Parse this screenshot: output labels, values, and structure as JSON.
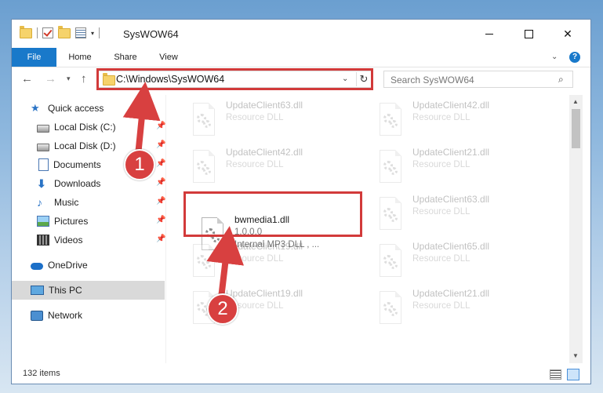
{
  "window": {
    "title": "SysWOW64"
  },
  "ribbon": {
    "tabs": [
      "File",
      "Home",
      "Share",
      "View"
    ]
  },
  "nav": {
    "address": "C:\\Windows\\SysWOW64",
    "search_placeholder": "Search SysWOW64"
  },
  "sidebar": {
    "items": [
      {
        "label": "Quick access",
        "icon": "star-icon"
      },
      {
        "label": "Local Disk (C:)",
        "icon": "disk-icon",
        "pinned": true
      },
      {
        "label": "Local Disk (D:)",
        "icon": "disk-icon",
        "pinned": true
      },
      {
        "label": "Documents",
        "icon": "documents-icon",
        "pinned": true
      },
      {
        "label": "Downloads",
        "icon": "downloads-icon",
        "pinned": true
      },
      {
        "label": "Music",
        "icon": "music-icon",
        "pinned": true
      },
      {
        "label": "Pictures",
        "icon": "pictures-icon",
        "pinned": true
      },
      {
        "label": "Videos",
        "icon": "videos-icon",
        "pinned": true
      },
      {
        "label": "OneDrive",
        "icon": "onedrive-icon"
      },
      {
        "label": "This PC",
        "icon": "pc-icon",
        "selected": true
      },
      {
        "label": "Network",
        "icon": "network-icon"
      }
    ]
  },
  "files": [
    {
      "name": "UpdateClient63.dll",
      "desc": "Resource DLL"
    },
    {
      "name": "UpdateClient42.dll",
      "desc": "Resource DLL"
    },
    {
      "name": "UpdateClient42.dll",
      "desc": "Resource DLL"
    },
    {
      "name": "UpdateClient21.dll",
      "desc": "Resource DLL"
    },
    {
      "name": "bwmedia1.dll",
      "version": "1.0.0.0",
      "desc": "Internal MP3 DLL , ..."
    },
    {
      "name": "UpdateClient63.dll",
      "desc": "Resource DLL"
    },
    {
      "name": "UpdateClient19.dll",
      "desc": "Resource DLL"
    },
    {
      "name": "UpdateClient65.dll",
      "desc": "Resource DLL"
    },
    {
      "name": "UpdateClient19.dll",
      "desc": "Resource DLL"
    },
    {
      "name": "UpdateClient21.dll",
      "desc": "Resource DLL"
    }
  ],
  "status": {
    "item_count": "132 items"
  },
  "annotations": {
    "step1": "1",
    "step2": "2",
    "color": "#d23a3a"
  }
}
